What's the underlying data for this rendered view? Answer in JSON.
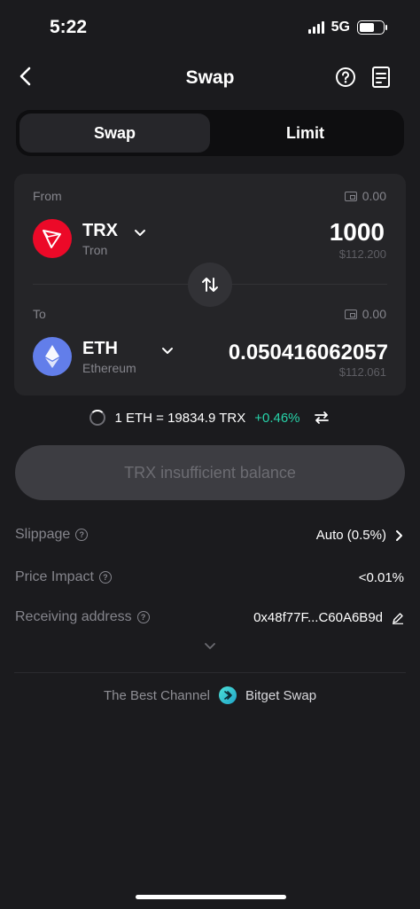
{
  "status_bar": {
    "time": "5:22",
    "network": "5G",
    "battery_level": 0.62
  },
  "header": {
    "title": "Swap",
    "back_icon": "chevron-left-icon",
    "help_icon": "question-circle-icon",
    "history_icon": "document-icon"
  },
  "tabs": [
    {
      "label": "Swap",
      "active": true
    },
    {
      "label": "Limit",
      "active": false
    }
  ],
  "from": {
    "label": "From",
    "balance": "0.00",
    "symbol": "TRX",
    "name": "Tron",
    "amount": "1000",
    "fiat": "$112.200",
    "icon_color": "#ec0928"
  },
  "to": {
    "label": "To",
    "balance": "0.00",
    "symbol": "ETH",
    "name": "Ethereum",
    "amount": "0.050416062057",
    "fiat": "$112.061",
    "icon_color": "#627eea"
  },
  "rate": {
    "text": "1 ETH = 19834.9 TRX",
    "change": "+0.46%"
  },
  "main_button": {
    "label": "TRX insufficient balance"
  },
  "details": {
    "slippage": {
      "label": "Slippage",
      "value": "Auto (0.5%)"
    },
    "price_impact": {
      "label": "Price Impact",
      "value": "<0.01%"
    },
    "receiving_address": {
      "label": "Receiving address",
      "value": "0x48f77F...C60A6B9d"
    }
  },
  "footer": {
    "channel_label": "The Best Channel",
    "brand": "Bitget Swap"
  },
  "colors": {
    "background": "#1b1b1e",
    "card": "#252528",
    "accent_green": "#27d3a9"
  }
}
